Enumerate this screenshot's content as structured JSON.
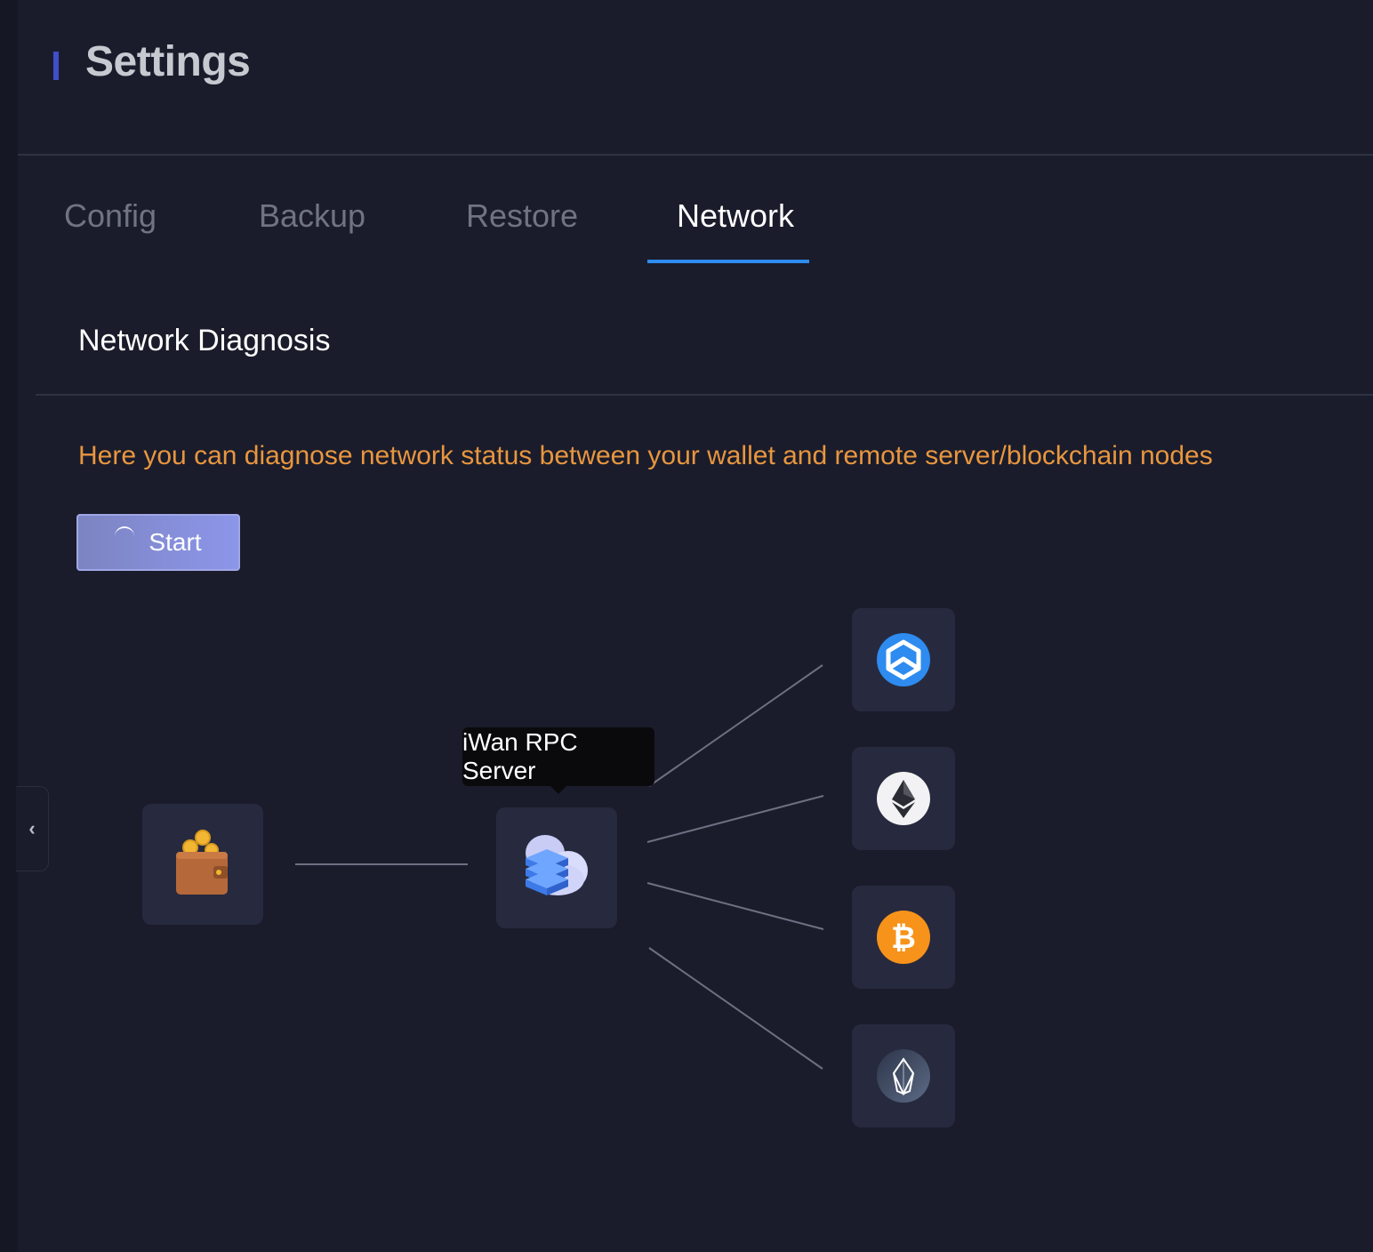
{
  "header": {
    "title": "Settings"
  },
  "tabs": [
    {
      "label": "Config",
      "active": false
    },
    {
      "label": "Backup",
      "active": false
    },
    {
      "label": "Restore",
      "active": false
    },
    {
      "label": "Network",
      "active": true
    }
  ],
  "section": {
    "title": "Network Diagnosis",
    "description": "Here you can diagnose network status between your wallet and remote server/blockchain nodes"
  },
  "start_button": {
    "label": "Start",
    "loading": true
  },
  "diagram": {
    "wallet": {
      "icon": "wallet-icon"
    },
    "server": {
      "icon": "cloud-server-icon",
      "tooltip": "iWan RPC Server"
    },
    "chains": [
      {
        "icon": "wanchain-icon"
      },
      {
        "icon": "ethereum-icon"
      },
      {
        "icon": "bitcoin-icon"
      },
      {
        "icon": "eos-icon"
      }
    ]
  },
  "colors": {
    "background": "#1a1c2b",
    "accent_blue": "#2e8bf0",
    "warning_orange": "#e8963f",
    "button": "#8c96ea"
  }
}
